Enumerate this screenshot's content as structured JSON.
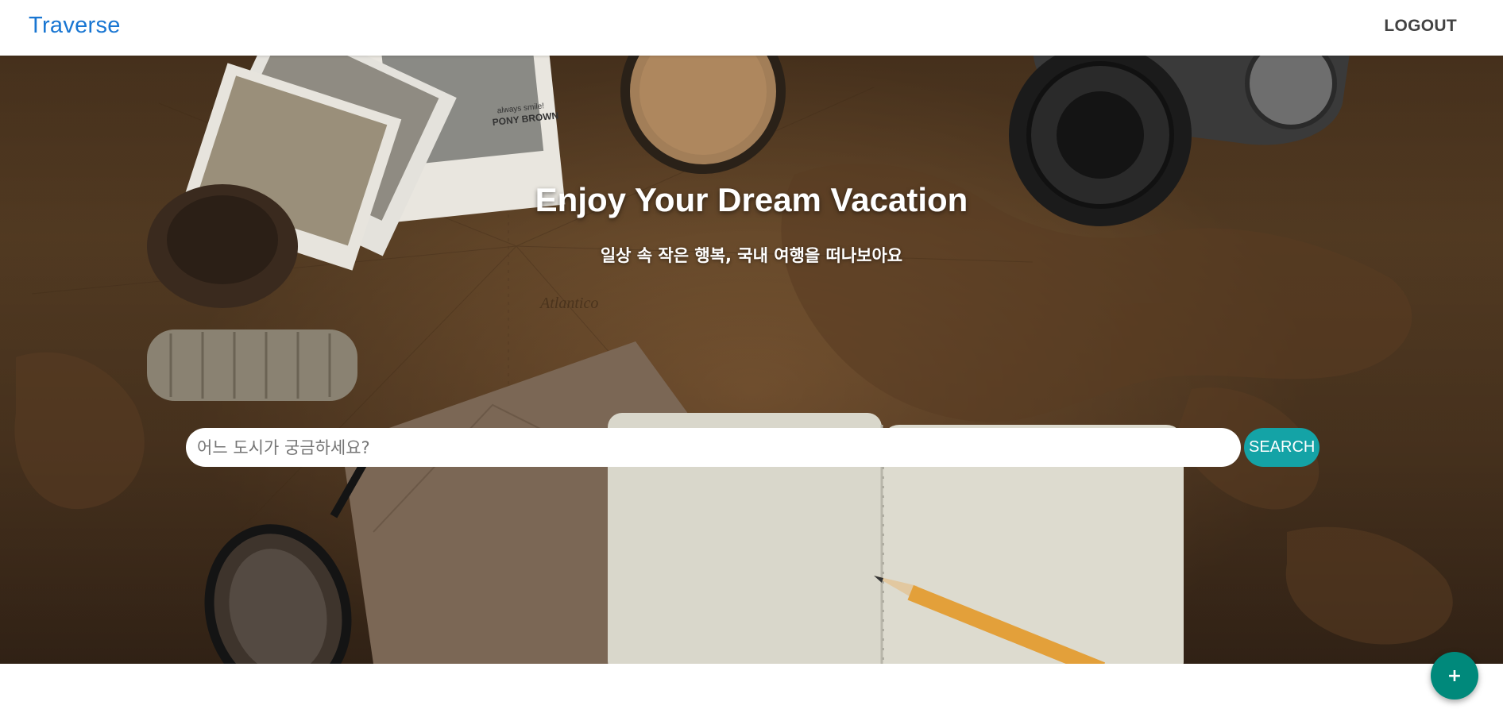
{
  "app": {
    "brand": "Traverse"
  },
  "nav": {
    "logout_label": "LOGOUT"
  },
  "hero": {
    "title": "Enjoy Your Dream Vacation",
    "subtitle": "일상 속 작은 행복, 국내 여행을 떠나보아요",
    "image_text": {
      "photo_caption_1": "always smile!",
      "photo_caption_2": "PONY BROWN",
      "map_label": "Atlantico"
    }
  },
  "search": {
    "placeholder": "어느 도시가 궁금하세요?",
    "value": "",
    "button_label": "SEARCH"
  },
  "fab": {
    "label": "+"
  },
  "colors": {
    "brand": "#1976d2",
    "search_button": "#14a3a6",
    "fab": "#00897b"
  }
}
